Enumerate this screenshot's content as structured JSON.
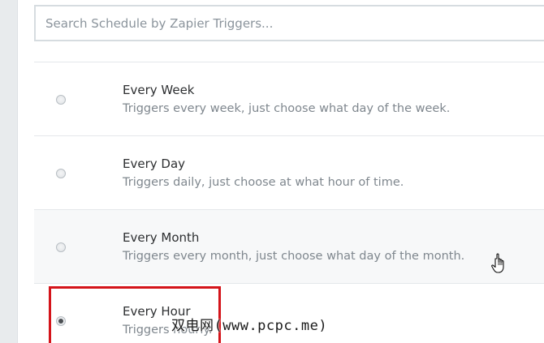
{
  "search": {
    "placeholder": "Search Schedule by Zapier Triggers..."
  },
  "triggers": [
    {
      "title": "Every Week",
      "description": "Triggers every week, just choose what day of the week.",
      "selected": false
    },
    {
      "title": "Every Day",
      "description": "Triggers daily, just choose at what hour of time.",
      "selected": false
    },
    {
      "title": "Every Month",
      "description": "Triggers every month, just choose what day of the month.",
      "selected": false
    },
    {
      "title": "Every Hour",
      "description": "Triggers hourly.",
      "selected": true
    }
  ],
  "watermark": "双电网(www.pcpc.me)",
  "colors": {
    "highlight": "#d4141a",
    "title_text": "#2d2f31",
    "description_text": "#7f878e"
  }
}
